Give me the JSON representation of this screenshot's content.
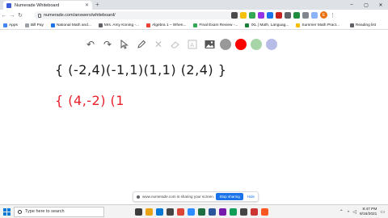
{
  "browser": {
    "tab_title": "Numerade Whiteboard",
    "url": "numerade.com/answers/whiteboard/",
    "profile_initial": "E"
  },
  "bookmarks": [
    {
      "label": "Apps",
      "color": "#4285f4"
    },
    {
      "label": "Bill Pay",
      "color": "#9aa0a6"
    },
    {
      "label": "National Math and...",
      "color": "#1a73e8"
    },
    {
      "label": "Mrs. Amy Koning -...",
      "color": "#5f6368"
    },
    {
      "label": "Algebra 1 – When...",
      "color": "#ea4335"
    },
    {
      "label": "Final Exam Review -...",
      "color": "#34a853"
    },
    {
      "label": "IXL | Math, Languag...",
      "color": "#188038"
    },
    {
      "label": "Summer Math Pract...",
      "color": "#fbbc04"
    }
  ],
  "reading_list": "Reading list",
  "whiteboard": {
    "colors": {
      "gray": "#999999",
      "red": "#ff0000",
      "green": "#a8d5a8",
      "lavender": "#b8bde8"
    },
    "line1": "{ (-2,4)(-1,1)(1,1) (2,4) }",
    "line2": "{ (4,-2) (1"
  },
  "share_banner": {
    "message": "www.numerade.com is sharing your screen.",
    "stop_label": "Stop sharing",
    "hide_label": "Hide"
  },
  "taskbar": {
    "search_placeholder": "Type here to search",
    "time": "8:47 PM",
    "date": "8/16/2021"
  }
}
